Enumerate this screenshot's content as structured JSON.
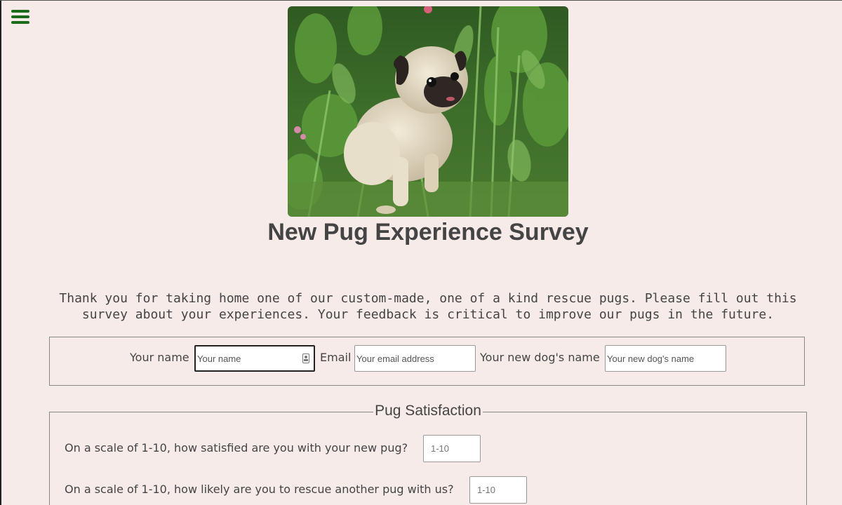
{
  "nav": {
    "menu_icon": "hamburger-menu-icon",
    "accent_color": "#1a6b1a"
  },
  "hero": {
    "image": "pug-sitting-in-garden-photo"
  },
  "title": "New Pug Experience Survey",
  "intro": "Thank you for taking home one of our custom-made, one of a kind rescue pugs. Please fill out this survey about your experiences. Your feedback is critical to improve our pugs in the future.",
  "contact": {
    "name_label": "Your name",
    "name_placeholder": "Your name",
    "name_value": "",
    "email_label": "Email",
    "email_placeholder": "Your email address",
    "email_value": "",
    "dog_label": "Your new dog's name",
    "dog_placeholder": "Your new dog's name",
    "dog_value": ""
  },
  "satisfaction": {
    "legend": "Pug Satisfaction",
    "questions": [
      {
        "label": "On a scale of 1-10, how satisfied are you with your new pug?",
        "placeholder": "1-10"
      },
      {
        "label": "On a scale of 1-10, how likely are you to rescue another pug with us?",
        "placeholder": "1-10"
      }
    ]
  },
  "colors": {
    "background": "#f6ebe9",
    "text": "#444444"
  }
}
